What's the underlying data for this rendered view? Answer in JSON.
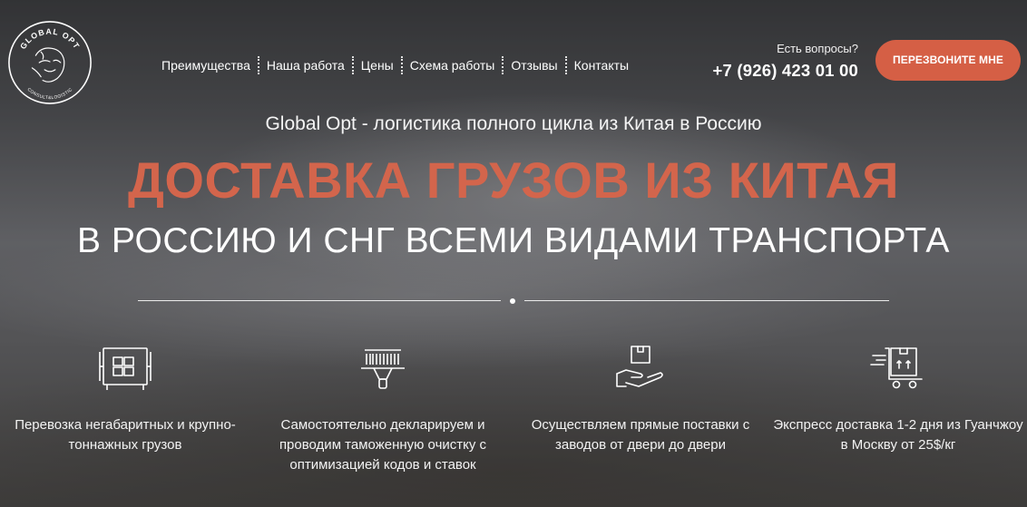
{
  "logo": {
    "top_text": "GLOBAL OPT",
    "bottom_text": "CONSULT&LOGISTIC"
  },
  "nav": {
    "items": [
      {
        "label": "Преимущества"
      },
      {
        "label": "Наша работа"
      },
      {
        "label": "Цены"
      },
      {
        "label": "Схема работы"
      },
      {
        "label": "Отзывы"
      },
      {
        "label": "Контакты"
      }
    ]
  },
  "contact": {
    "question": "Есть вопросы?",
    "phone": "+7 (926) 423 01 00",
    "callback_label": "ПЕРЕЗВОНИТЕ МНЕ"
  },
  "hero": {
    "subtitle": "Global Opt - логистика полного цикла из Китая в Россию",
    "title": "ДОСТАВКА ГРУЗОВ ИЗ КИТАЯ",
    "title2": "В РОССИЮ И СНГ ВСЕМИ ВИДАМИ ТРАНСПОРТА"
  },
  "features": [
    {
      "icon": "container-icon",
      "text": "Перевозка негабаритных и крупно-тоннажных грузов"
    },
    {
      "icon": "barcode-scanner-icon",
      "text": "Самостоятельно декларируем и проводим таможенную очистку с оптимизацией кодов и ставок"
    },
    {
      "icon": "hand-box-icon",
      "text": "Осуществляем прямые поставки с заводов от двери до двери"
    },
    {
      "icon": "express-cart-icon",
      "text": "Экспресс доставка 1-2 дня из Гуанчжоу в Москву от 25$/кг"
    }
  ],
  "colors": {
    "accent": "#d55f45",
    "title": "#d3654c",
    "text": "#ffffff"
  }
}
